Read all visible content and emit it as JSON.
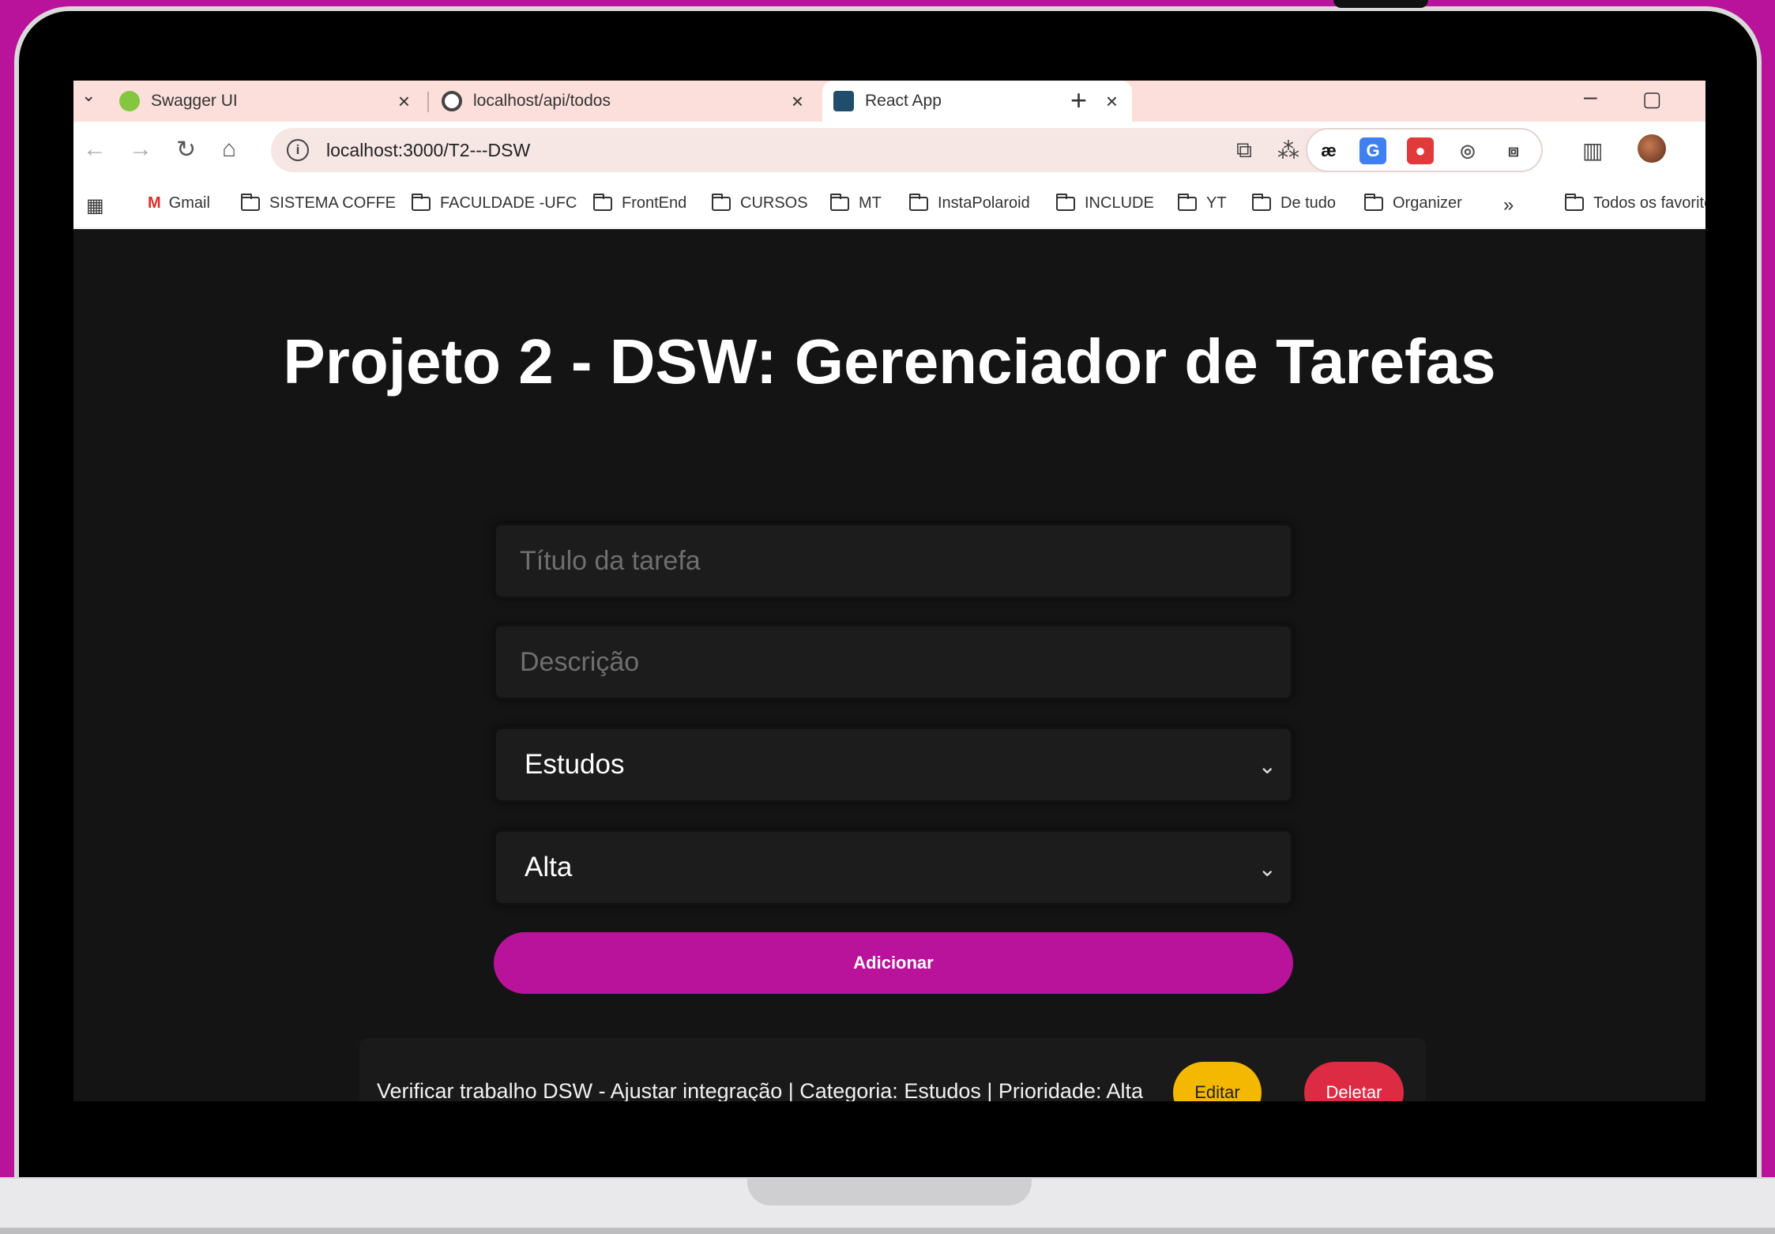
{
  "browser": {
    "tabs": [
      {
        "title": "Swagger UI",
        "favicon_color": "#85c640"
      },
      {
        "title": "localhost/api/todos",
        "favicon_color": "#444444"
      },
      {
        "title": "React App",
        "favicon_color": "#1f4d6b"
      }
    ],
    "active_tab": 2,
    "new_tab_label": "+",
    "close_label": "×",
    "url": "localhost:3000/T2---DSW",
    "bookmarks": {
      "gmail": "Gmail",
      "items": [
        "SISTEMA COFFE",
        "FACULDADE -UFC",
        "FrontEnd",
        "CURSOS",
        "MT",
        "InstaPolaroid",
        "INCLUDE",
        "YT",
        "De tudo",
        "Organizer"
      ],
      "overflow": "»",
      "all_bookmarks": "Todos os favoritos"
    },
    "extension_label": "æ"
  },
  "page": {
    "title": "Projeto 2 - DSW: Gerenciador de Tarefas",
    "form": {
      "title_placeholder": "Título da tarefa",
      "description_placeholder": "Descrição",
      "category_value": "Estudos",
      "priority_value": "Alta",
      "submit_label": "Adicionar"
    },
    "tasks": [
      {
        "text": "Verificar trabalho DSW - Ajustar integração | Categoria: Estudos | Prioridade: Alta",
        "edit_label": "Editar",
        "delete_label": "Deletar"
      }
    ]
  },
  "colors": {
    "background": "#b8139a",
    "accent": "#b8139a",
    "edit": "#f5b800",
    "delete": "#dc2b43",
    "page_bg": "#141414"
  }
}
